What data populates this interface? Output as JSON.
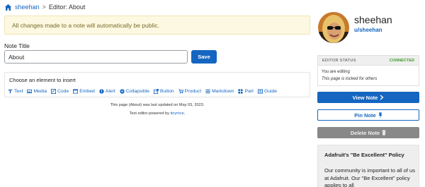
{
  "breadcrumb": {
    "icon": "home-icon",
    "user_link": "sheehan",
    "separator": ">",
    "current": "Editor: About"
  },
  "notice": {
    "text": "All changes made to a note will automatically be public."
  },
  "note_form": {
    "title_label": "Note Title",
    "title_value": "About",
    "save_label": "Save"
  },
  "insert_panel": {
    "title": "Choose an element to insert",
    "items": [
      {
        "label": "Text",
        "icon": "text-icon"
      },
      {
        "label": "Media",
        "icon": "media-icon"
      },
      {
        "label": "Code",
        "icon": "code-icon"
      },
      {
        "label": "Embed",
        "icon": "embed-icon"
      },
      {
        "label": "Alert",
        "icon": "alert-icon"
      },
      {
        "label": "Collapsible",
        "icon": "collapsible-icon"
      },
      {
        "label": "Button",
        "icon": "button-icon"
      },
      {
        "label": "Product",
        "icon": "product-icon"
      },
      {
        "label": "Markdown",
        "icon": "markdown-icon"
      },
      {
        "label": "Part",
        "icon": "part-icon"
      },
      {
        "label": "Guide",
        "icon": "guide-icon"
      }
    ]
  },
  "footer": {
    "updated_text": "This page (About) was last updated on May 03, 2023.",
    "powered_prefix": "Text editor powered by ",
    "powered_link": "tinymce",
    "powered_suffix": "."
  },
  "sidebar": {
    "username": "sheehan",
    "handle": "u/sheehan",
    "editor_status": {
      "label": "EDITOR STATUS",
      "state": "CONNECTED",
      "line1": "You are editing",
      "line2": "This page is locked for others"
    },
    "buttons": {
      "view": "View Note",
      "pin": "Pin Note",
      "delete": "Delete Note"
    },
    "policy": {
      "title": "Adafruit's \"Be Excellent\" Policy",
      "body": "Our community is important to all of us at Adafruit. Our \"Be Excellent\" policy applies to all"
    }
  },
  "colors": {
    "accent": "#1566c0",
    "notice_bg": "#fdf8e1",
    "connected": "#3a9a2a",
    "delete_bg": "#888888"
  }
}
